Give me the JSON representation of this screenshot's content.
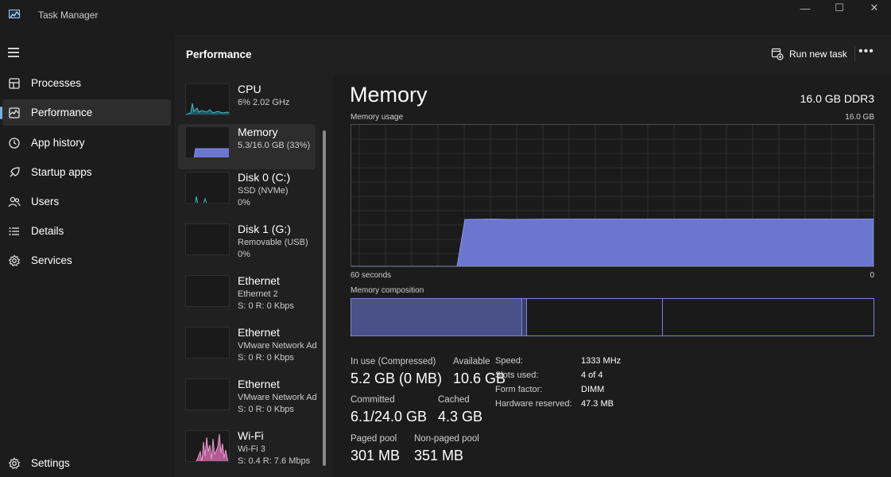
{
  "window": {
    "title": "Task Manager",
    "controls": {
      "minimize": "—",
      "maximize": "☐",
      "close": "✕"
    }
  },
  "nav": {
    "items": [
      {
        "label": "Processes",
        "icon": "processes-icon",
        "active": false
      },
      {
        "label": "Performance",
        "icon": "performance-icon",
        "active": true
      },
      {
        "label": "App history",
        "icon": "app-history-icon",
        "active": false
      },
      {
        "label": "Startup apps",
        "icon": "startup-apps-icon",
        "active": false
      },
      {
        "label": "Users",
        "icon": "users-icon",
        "active": false
      },
      {
        "label": "Details",
        "icon": "details-icon",
        "active": false
      },
      {
        "label": "Services",
        "icon": "services-icon",
        "active": false
      }
    ],
    "settings": "Settings"
  },
  "header": {
    "title": "Performance",
    "run_new_task": "Run new task",
    "more": "•••"
  },
  "devices": [
    {
      "name": "CPU",
      "sub1": "6%  2.02 GHz",
      "sub2": "",
      "color": "#3fb8c9",
      "active": false
    },
    {
      "name": "Memory",
      "sub1": "5.3/16.0 GB (33%)",
      "sub2": "",
      "color": "#6b76d1",
      "active": true
    },
    {
      "name": "Disk 0 (C:)",
      "sub1": "SSD (NVMe)",
      "sub2": "0%",
      "color": "#3fb8c9",
      "active": false
    },
    {
      "name": "Disk 1 (G:)",
      "sub1": "Removable (USB)",
      "sub2": "0%",
      "color": "#3fb8c9",
      "active": false
    },
    {
      "name": "Ethernet",
      "sub1": "Ethernet 2",
      "sub2": "S: 0  R: 0 Kbps",
      "color": "#d27ab0",
      "active": false
    },
    {
      "name": "Ethernet",
      "sub1": "VMware Network Ad",
      "sub2": "S: 0  R: 0 Kbps",
      "color": "#d27ab0",
      "active": false
    },
    {
      "name": "Ethernet",
      "sub1": "VMware Network Ad",
      "sub2": "S: 0  R: 0 Kbps",
      "color": "#d27ab0",
      "active": false
    },
    {
      "name": "Wi-Fi",
      "sub1": "Wi-Fi 3",
      "sub2": "S: 0.4  R: 7.6 Mbps",
      "color": "#d27ab0",
      "active": false
    }
  ],
  "detail": {
    "title": "Memory",
    "spec": "16.0 GB DDR3",
    "usage_label": "Memory usage",
    "usage_max": "16.0 GB",
    "time_left": "60 seconds",
    "time_right": "0",
    "composition_label": "Memory composition",
    "stats": {
      "in_use_label": "In use (Compressed)",
      "in_use_value": "5.2 GB (0 MB)",
      "available_label": "Available",
      "available_value": "10.6 GB",
      "committed_label": "Committed",
      "committed_value": "6.1/24.0 GB",
      "cached_label": "Cached",
      "cached_value": "4.3 GB",
      "paged_label": "Paged pool",
      "paged_value": "301 MB",
      "nonpaged_label": "Non-paged pool",
      "nonpaged_value": "351 MB"
    },
    "specs": [
      {
        "key": "Speed:",
        "value": "1333 MHz"
      },
      {
        "key": "Slots used:",
        "value": "4 of 4"
      },
      {
        "key": "Form factor:",
        "value": "DIMM"
      },
      {
        "key": "Hardware reserved:",
        "value": "47.3 MB"
      }
    ]
  },
  "colors": {
    "memory": "#6b76d1",
    "cpu_disk": "#3fb8c9",
    "network": "#d27ab0",
    "accent": "#7ab0e6"
  }
}
